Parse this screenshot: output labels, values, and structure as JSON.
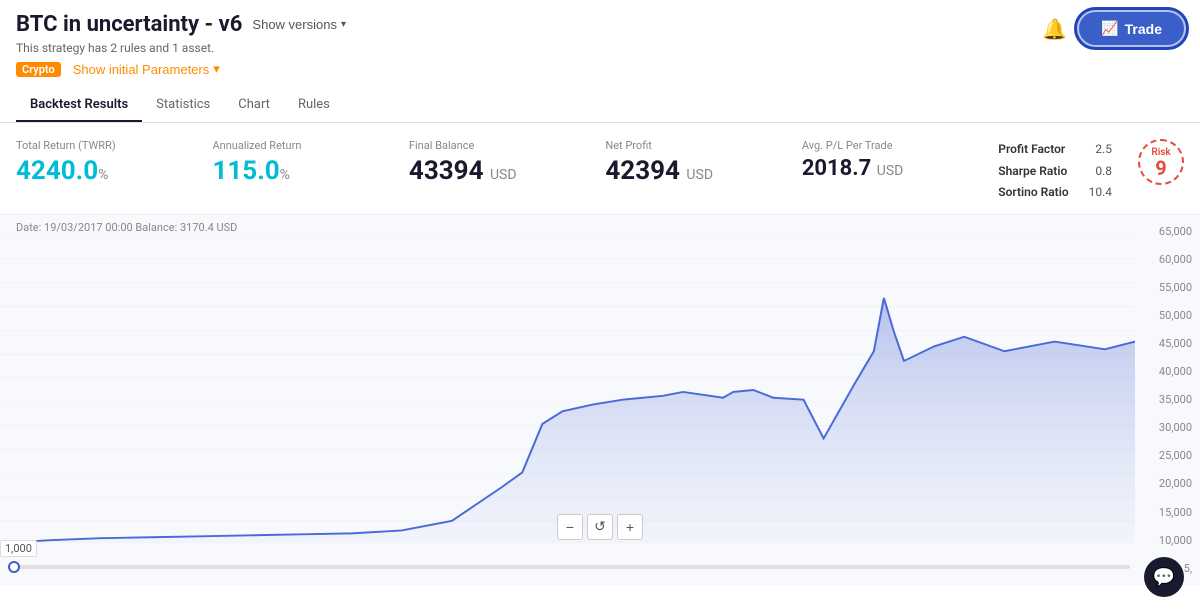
{
  "header": {
    "title": "BTC in uncertainty - v6",
    "show_versions_label": "Show versions",
    "subtitle": "This strategy has 2 rules and 1 asset.",
    "crypto_badge": "Crypto",
    "show_params_label": "Show initial Parameters",
    "trade_button_label": "Trade"
  },
  "tabs": [
    {
      "id": "backtest",
      "label": "Backtest Results",
      "active": true
    },
    {
      "id": "statistics",
      "label": "Statistics",
      "active": false
    },
    {
      "id": "chart",
      "label": "Chart",
      "active": false
    },
    {
      "id": "rules",
      "label": "Rules",
      "active": false
    }
  ],
  "metrics": [
    {
      "id": "total-return",
      "label": "Total Return (TWRR)",
      "value": "4240.0",
      "unit": "%",
      "teal": true
    },
    {
      "id": "annualized-return",
      "label": "Annualized Return",
      "value": "115.0",
      "unit": "%",
      "teal": true
    },
    {
      "id": "final-balance",
      "label": "Final Balance",
      "value": "43394",
      "unit": "USD",
      "teal": false
    },
    {
      "id": "net-profit",
      "label": "Net Profit",
      "value": "42394",
      "unit": "USD",
      "teal": false
    },
    {
      "id": "avg-pl",
      "label": "Avg. P/L Per Trade",
      "value": "2018.7",
      "unit": "USD",
      "teal": false
    }
  ],
  "ratios": {
    "profit_factor_label": "Profit Factor",
    "profit_factor_value": "2.5",
    "sharpe_ratio_label": "Sharpe Ratio",
    "sharpe_ratio_value": "0.8",
    "sortino_ratio_label": "Sortino Ratio",
    "sortino_ratio_value": "10.4"
  },
  "risk": {
    "label": "Risk",
    "value": "9"
  },
  "chart": {
    "date_label": "Date: 19/03/2017 00:00 Balance: 3170.4 USD",
    "y_labels": [
      "65,000",
      "60,000",
      "55,000",
      "50,000",
      "45,000",
      "40,000",
      "35,000",
      "30,000",
      "25,000",
      "20,000",
      "15,000",
      "10,000",
      "5,"
    ],
    "zoom_minus": "−",
    "zoom_refresh": "↺",
    "zoom_plus": "+",
    "slider_value": "1,000"
  }
}
